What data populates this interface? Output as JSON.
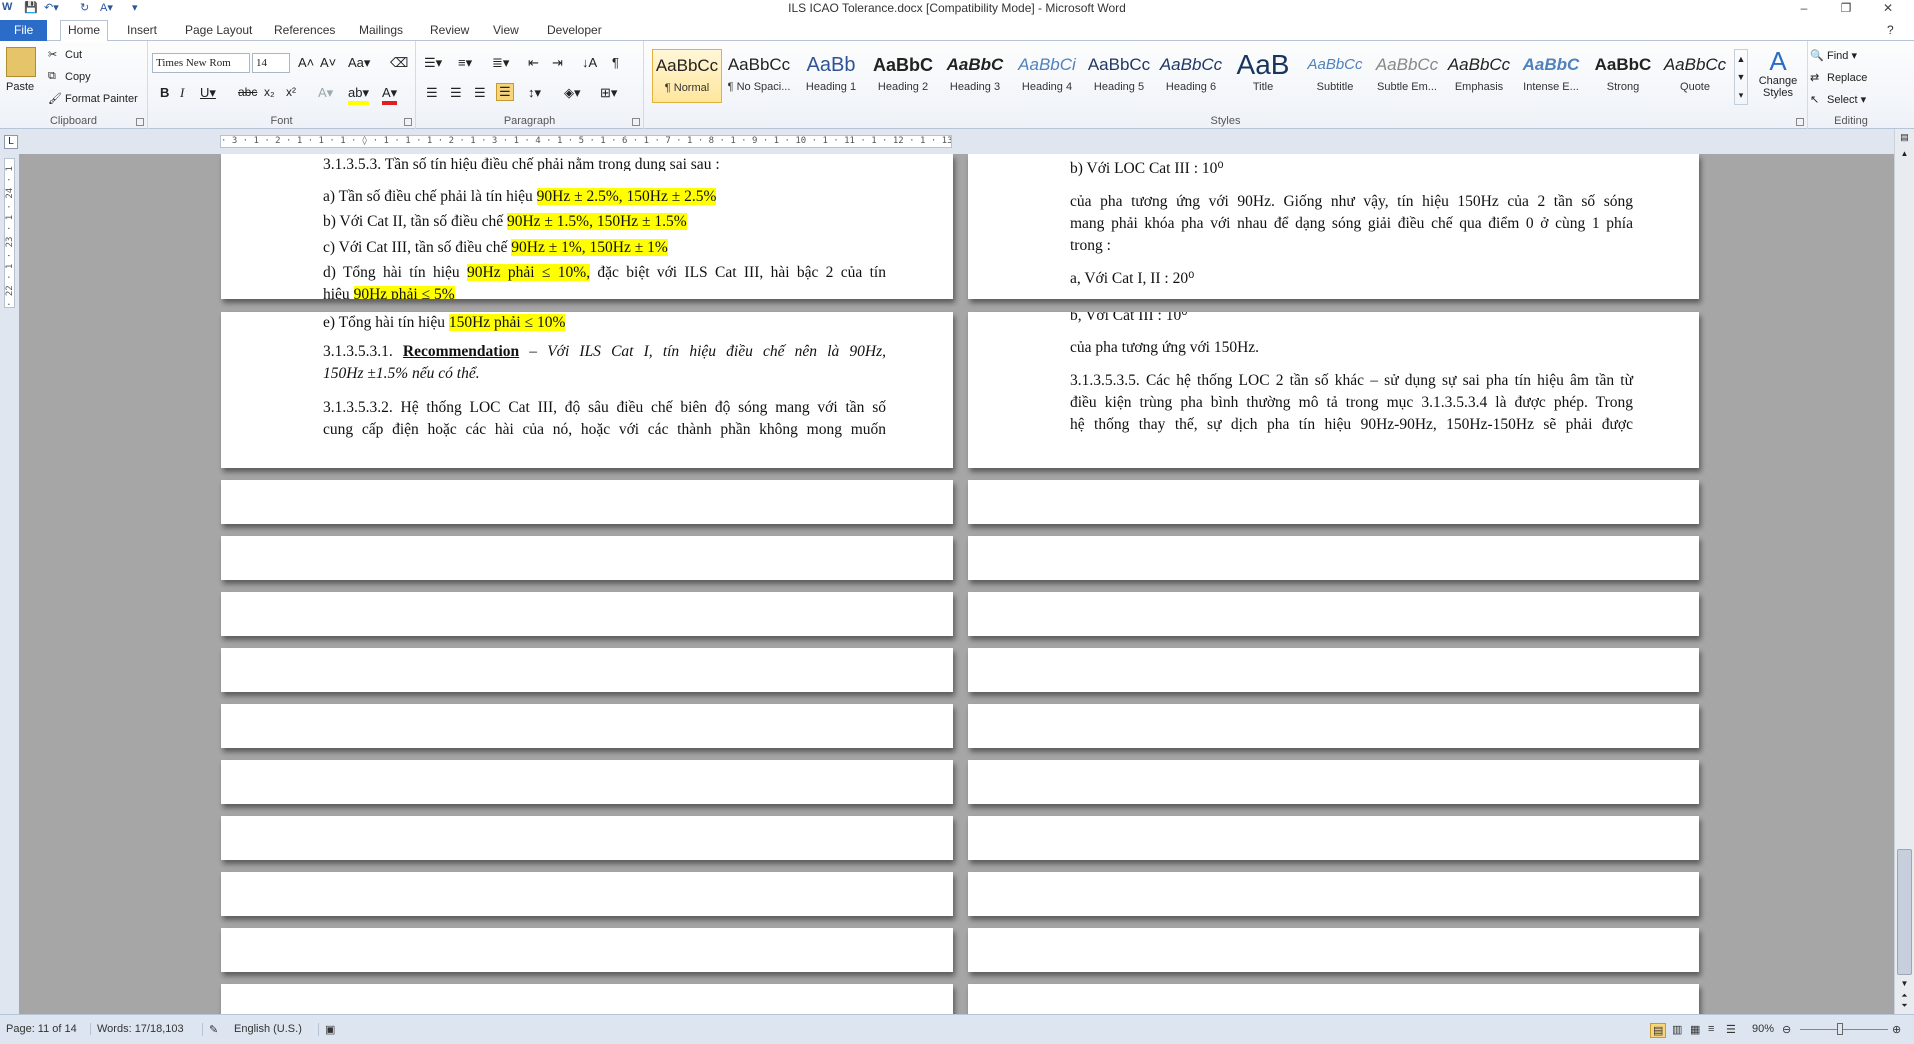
{
  "window": {
    "title": "ILS ICAO Tolerance.docx [Compatibility Mode] - Microsoft Word",
    "controls": {
      "help": "?",
      "minimize": "–",
      "restore": "❐",
      "close": "✕"
    }
  },
  "tabs": [
    "File",
    "Home",
    "Insert",
    "Page Layout",
    "References",
    "Mailings",
    "Review",
    "View",
    "Developer"
  ],
  "clipboard": {
    "label": "Clipboard",
    "paste": "Paste",
    "cut": "Cut",
    "copy": "Copy",
    "format_painter": "Format Painter"
  },
  "font": {
    "label": "Font",
    "name": "Times New Rom",
    "size": "14"
  },
  "paragraph": {
    "label": "Paragraph"
  },
  "styles": {
    "label": "Styles",
    "items": [
      {
        "preview": "AaBbCc",
        "name": "¶ Normal"
      },
      {
        "preview": "AaBbCc",
        "name": "¶ No Spaci..."
      },
      {
        "preview": "AaBb",
        "name": "Heading 1"
      },
      {
        "preview": "AaBbC",
        "name": "Heading 2"
      },
      {
        "preview": "AaBbC",
        "name": "Heading 3"
      },
      {
        "preview": "AaBbCi",
        "name": "Heading 4"
      },
      {
        "preview": "AaBbCc",
        "name": "Heading 5"
      },
      {
        "preview": "AaBbCc",
        "name": "Heading 6"
      },
      {
        "preview": "AaB",
        "name": "Title"
      },
      {
        "preview": "AaBbCc",
        "name": "Subtitle"
      },
      {
        "preview": "AaBbCc",
        "name": "Subtle Em..."
      },
      {
        "preview": "AaBbCc",
        "name": "Emphasis"
      },
      {
        "preview": "AaBbC",
        "name": "Intense E..."
      },
      {
        "preview": "AaBbC",
        "name": "Strong"
      },
      {
        "preview": "AaBbCc",
        "name": "Quote"
      }
    ],
    "change": "Change Styles"
  },
  "editing": {
    "label": "Editing",
    "find": "Find",
    "replace": "Replace",
    "select": "Select"
  },
  "ruler_text": "· 3 · 1 · 2 · 1 · 1 · 1 · ◊ · 1 · 1 · 1 · 2 · 1 · 3 · 1 · 4 · 1 · 5 · 1 · 6 · 1 · 7 · 1 · 8 · 1 · 9 · 1 · 10 · 1 · 11 · 1 · 12 · 1 · 13 · 1 · 14 · 1 · 15 · 1 · 16 · ◊ · 17 · 1 · 18 ·",
  "vruler_text": "· 22 · 1 · 23 · 1 · 24 · 1 · 25 · 1 · 26 ·",
  "left_page": {
    "l1": "3.1.3.5.3. Tần số tín hiệu điều chế phải nằm trong dung sai sau :",
    "l2_pre": "a) Tần số điều chế phải là tín hiệu ",
    "l2_hl": "90Hz ± 2.5%, 150Hz ± 2.5%",
    "l3_pre": "b) Với Cat II,  tần số điều chế ",
    "l3_hl": "90Hz ± 1.5%, 150Hz ± 1.5%",
    "l4_pre": "c) Với Cat III,  tần số điều chế ",
    "l4_hl": "90Hz ± 1%, 150Hz ± 1%",
    "l5_pre": "d) Tổng hài tín hiệu ",
    "l5_hl": "90Hz phải ≤ 10%,",
    "l5_post": " đặc biệt với ILS Cat III, hài bậc 2 của tín",
    "l6_pre": "hiệu ",
    "l6_hl": "90Hz phải ≤ 5%",
    "l7_pre": "e) Tổng hài tín hiệu ",
    "l7_hl": "150Hz phải ≤ 10%",
    "l8_num": "3.1.3.5.3.1. ",
    "l8_bold": "Recommendation",
    "l8_post": " – Với ILS Cat I, tín hiệu điều chế nên là 90Hz,",
    "l9": "150Hz ±1.5% nếu có thể.",
    "l10": "3.1.3.5.3.2. Hệ thống LOC Cat III, độ sâu điều chế biên độ sóng mang với tần số",
    "l11": "cung cấp điện hoặc các hài của nó, hoặc với các thành phần không mong muốn"
  },
  "right_page": {
    "r1": "b) Với LOC Cat III : 10⁰",
    "r2": "của pha tương ứng với 90Hz. Giống như vậy, tín hiệu 150Hz của 2 tần số sóng",
    "r3": "mang phải khóa pha với nhau để dạng sóng giải điều chế qua điểm 0 ở cùng 1 phía",
    "r4": "trong :",
    "r5": "a, Với Cat I, II : 20⁰",
    "r6": "b, Với Cat III : 10⁰",
    "r7": "của pha tương ứng với 150Hz.",
    "r8": "3.1.3.5.3.5. Các hệ thống LOC 2 tần số khác – sử dụng sự sai pha tín hiệu âm tần từ",
    "r9": "điều kiện trùng pha bình thường mô tả trong mục 3.1.3.5.3.4 là được phép. Trong",
    "r10": "hệ thống thay thế, sự dịch pha tín hiệu 90Hz-90Hz, 150Hz-150Hz sẽ phải được"
  },
  "status": {
    "page": "Page: 11 of 14",
    "words": "Words: 17/18,103",
    "language": "English (U.S.)",
    "zoom": "90%"
  }
}
